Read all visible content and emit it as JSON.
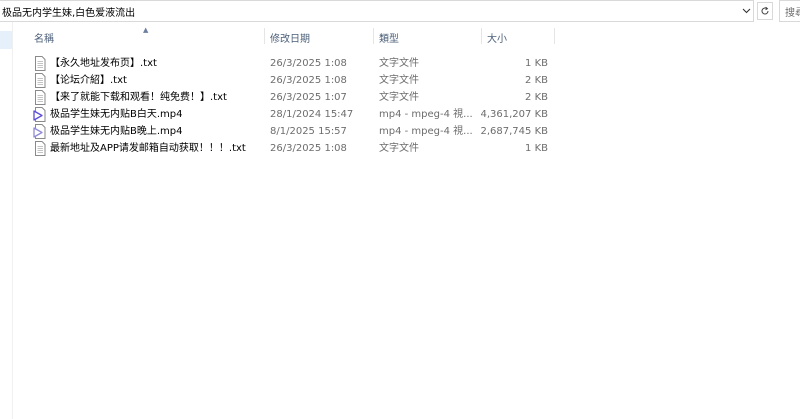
{
  "address": {
    "path": "极品无内学生妹,白色爱液流出"
  },
  "search": {
    "placeholder": "搜尋"
  },
  "columns": {
    "name": "名稱",
    "date": "修改日期",
    "type": "類型",
    "size": "大小"
  },
  "files": [
    {
      "name": "【永久地址发布页】.txt",
      "date": "26/3/2025 1:08",
      "type": "文字文件",
      "size": "1 KB",
      "icon": "text-file-icon"
    },
    {
      "name": "【论坛介紹】.txt",
      "date": "26/3/2025 1:08",
      "type": "文字文件",
      "size": "2 KB",
      "icon": "text-file-icon"
    },
    {
      "name": "【来了就能下载和观看！纯免费！】.txt",
      "date": "26/3/2025 1:07",
      "type": "文字文件",
      "size": "2 KB",
      "icon": "text-file-icon"
    },
    {
      "name": "极品学生妹无内贴B白天.mp4",
      "date": "28/1/2024 15:47",
      "type": "mp4 - mpeg-4 視...",
      "size": "4,361,207 KB",
      "icon": "video-file-icon"
    },
    {
      "name": "极品学生妹无内贴B晚上.mp4",
      "date": "8/1/2025 15:57",
      "type": "mp4 - mpeg-4 視...",
      "size": "2,687,745 KB",
      "icon": "video-file-icon"
    },
    {
      "name": "最新地址及APP请发邮箱自动获取！！！.txt",
      "date": "26/3/2025 1:08",
      "type": "文字文件",
      "size": "1 KB",
      "icon": "text-file-icon"
    }
  ],
  "colors": {
    "header_text": "#4c607a",
    "secondary_text": "#6d6d6d",
    "video_icon_accent": "#5b4fd6"
  }
}
